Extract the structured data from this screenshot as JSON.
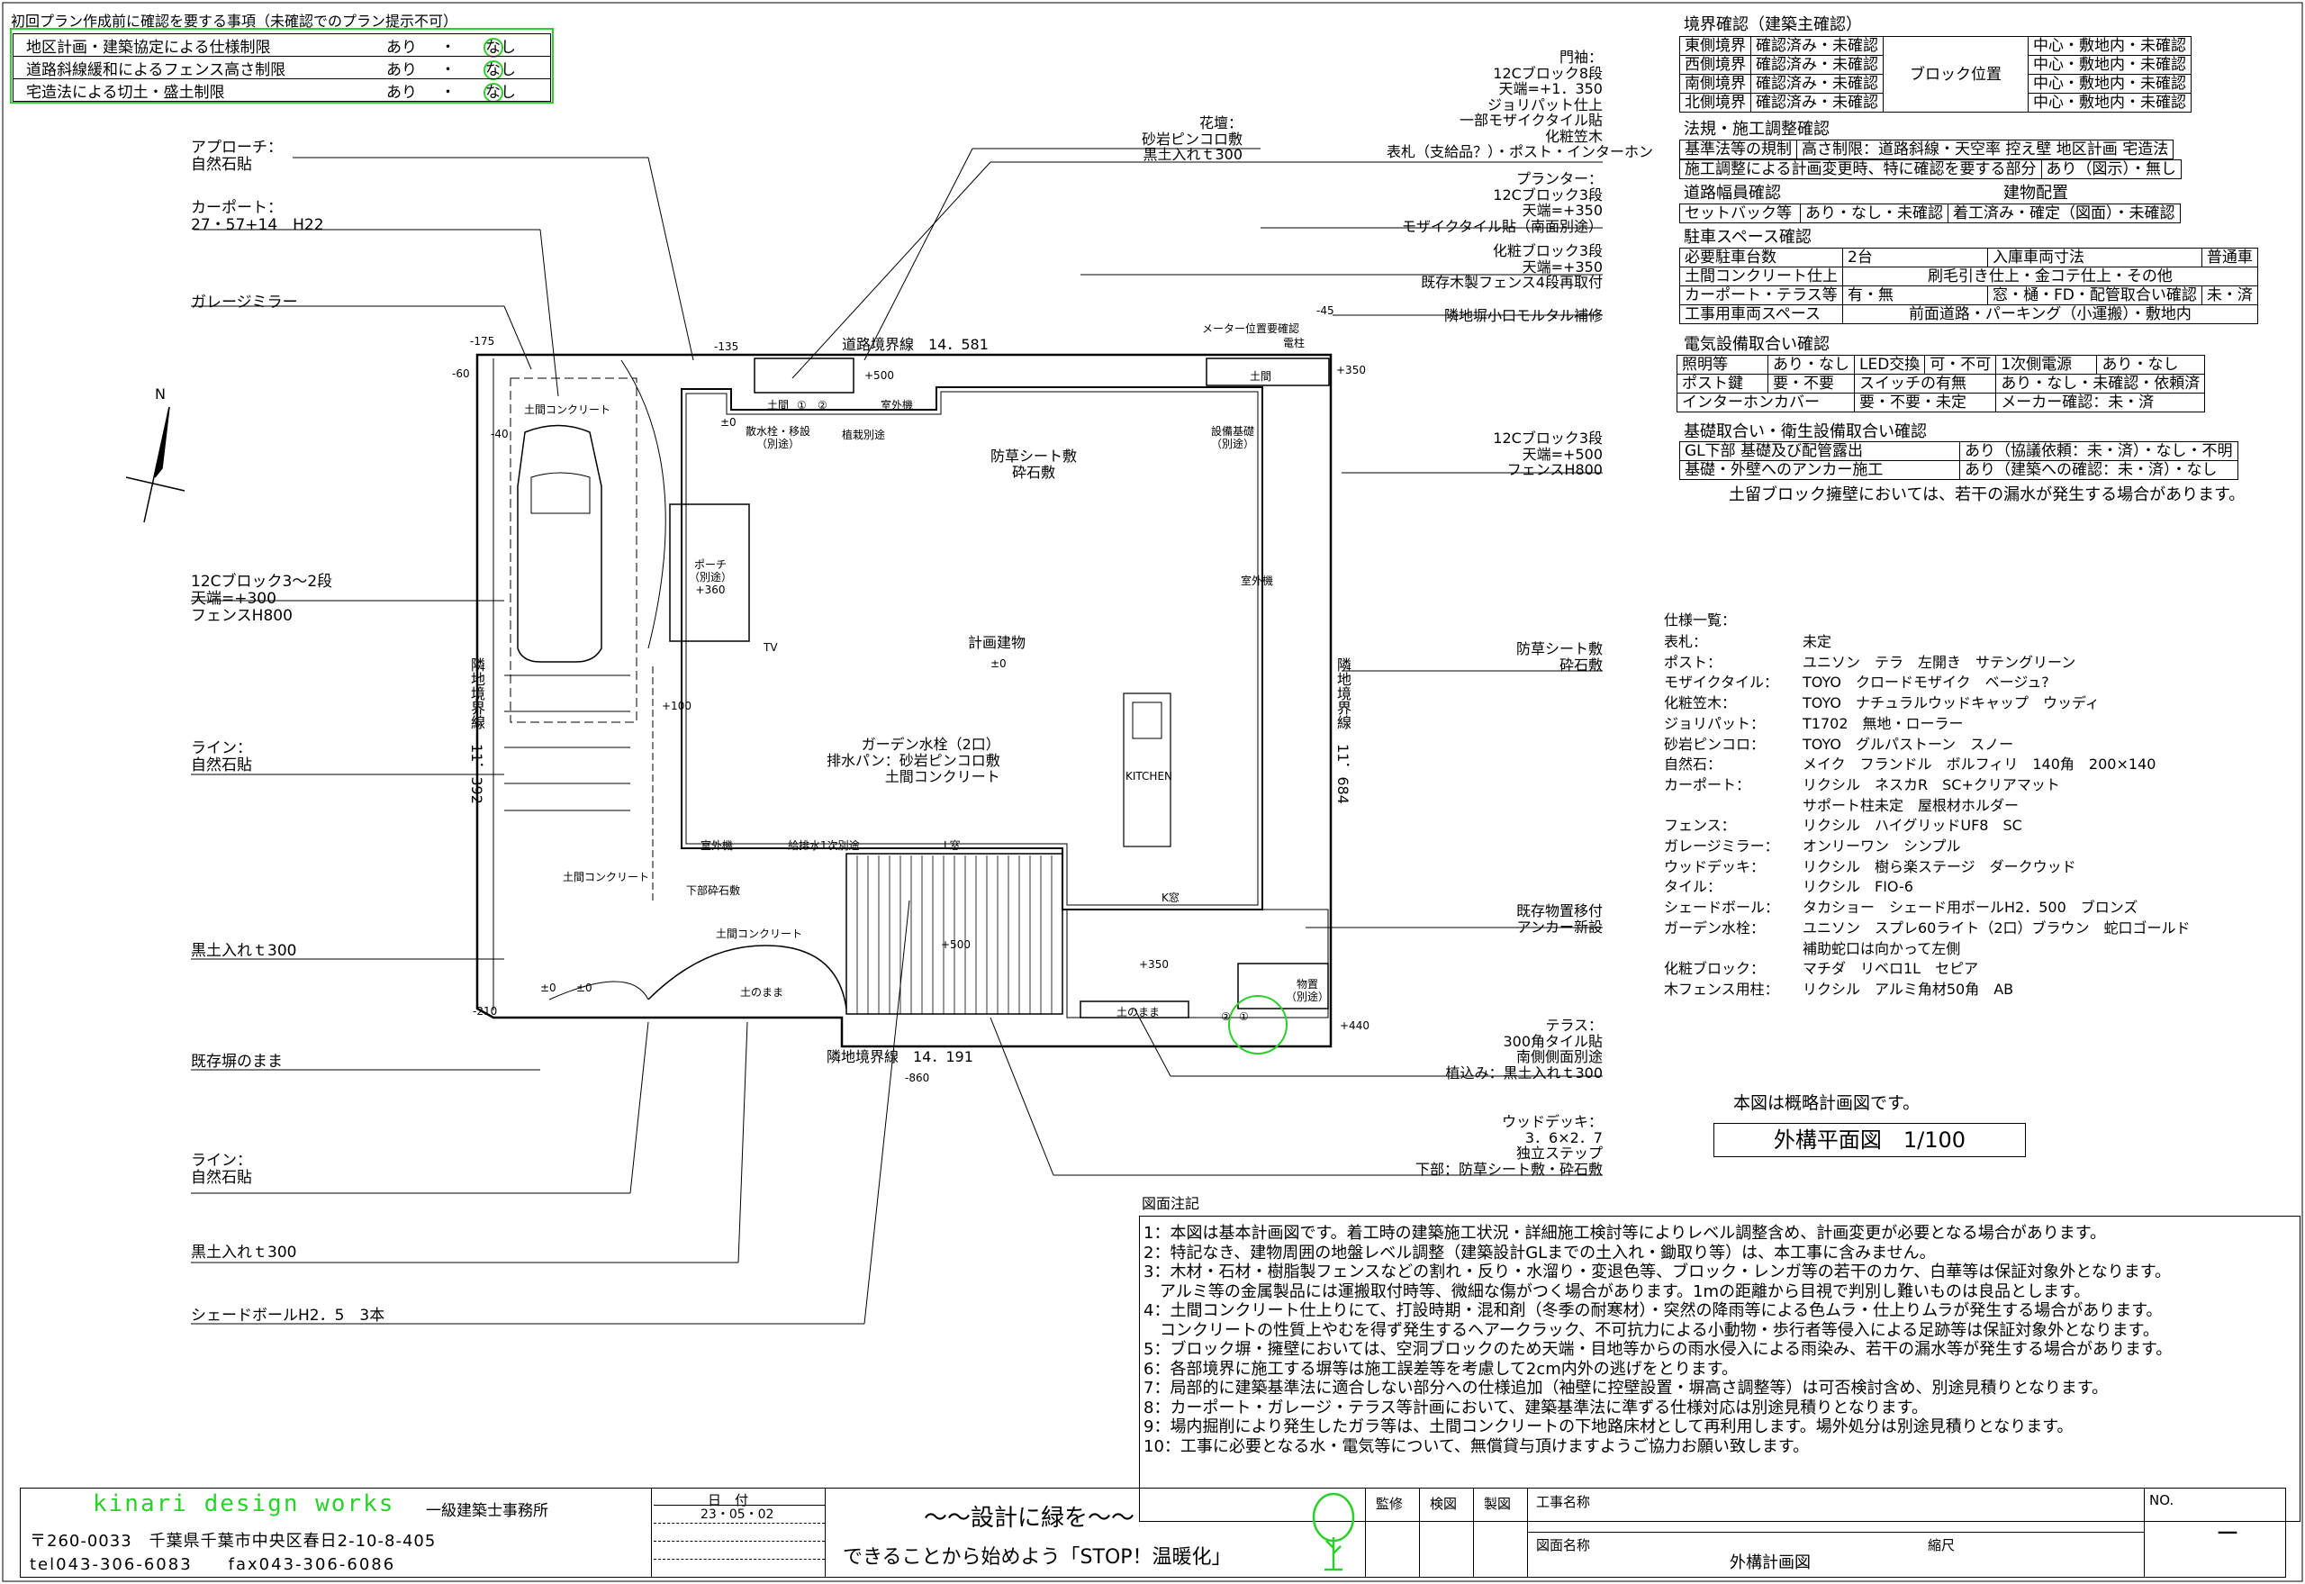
{
  "top_check": {
    "title": "初回プラン作成前に確認を要する事項（未確認でのプラン提示不可）",
    "rows": [
      {
        "item": "地区計画・建築協定による仕様制限",
        "opt1": "あり",
        "sep": "・",
        "opt2": "なし"
      },
      {
        "item": "道路斜線緩和によるフェンス高さ制限",
        "opt1": "あり",
        "sep": "・",
        "opt2": "なし"
      },
      {
        "item": "宅造法による切土・盛土制限",
        "opt1": "あり",
        "sep": "・",
        "opt2": "なし"
      }
    ]
  },
  "left_labels": [
    {
      "text": "アプローチ：\n自然石貼"
    },
    {
      "text": "カーポート：\n27・57+14　H22"
    },
    {
      "text": "ガレージミラー"
    },
    {
      "text": "12Cブロック3～2段\n天端=+300\nフェンスH800"
    },
    {
      "text": "ライン：\n自然石貼"
    },
    {
      "text": "黒土入れｔ300"
    },
    {
      "text": "既存塀のまま"
    },
    {
      "text": "ライン：\n自然石貼"
    },
    {
      "text": "黒土入れｔ300"
    },
    {
      "text": "シェードボールH2．5　3本"
    }
  ],
  "right_labels": [
    {
      "text": "門袖：\n12Cブロック8段\n天端=+1．350\nジョリパット仕上\n一部モザイクタイル貼\n化粧笠木\n表札（支給品？）・ポスト・インターホン"
    },
    {
      "text": "花壇：\n砂岩ピンコロ敷\n黒土入れｔ300"
    },
    {
      "text": "プランター：\n12Cブロック3段\n天端=+350\nモザイクタイル貼（南面別途）"
    },
    {
      "text": "化粧ブロック3段\n天端=+350\n既存木製フェンス4段再取付"
    },
    {
      "text": "隣地塀小口モルタル補修"
    },
    {
      "text": "12Cブロック3段\n天端=+500\nフェンスH800"
    },
    {
      "text": "防草シート敷\n砕石敷"
    },
    {
      "text": "既存物置移付\nアンカー新設"
    },
    {
      "text": "テラス：\n300角タイル貼\n南側側面別途\n植込み：黒土入れｔ300"
    },
    {
      "text": "ウッドデッキ：\n3．6×2．7\n独立ステップ\n下部：防草シート敷・砕石敷"
    }
  ],
  "plan": {
    "north": "N",
    "road": "道路境界線　14．581",
    "south": "隣地境界線　14．191",
    "west": "隣地境界線　11．392",
    "east": "隣地境界線　11．684",
    "building": "計画建物",
    "building_level": "±0",
    "garden_tap": "ガーデン水栓（2口）\n排水パン：砂岩ピンコロ敷\n土間コンクリート",
    "kitchen": "KITCHEN",
    "tv": "TV",
    "porch": "ポーチ\n（別途）\n+360",
    "grass": "防草シート敷\n砕石敷",
    "small_texts": [
      "散水栓・移設\n（別途）",
      "植栽別途",
      "室外機",
      "設備基礎\n（別途）",
      "室外機",
      "室外機",
      "給排水1次別途",
      "L窓",
      "K窓",
      "下部砕石敷",
      "土間コンクリート",
      "土間コンクリート",
      "土間コンクリート",
      "土のまま",
      "土のまま",
      "物置\n（別途）",
      "メーター位置要確認",
      "電柱",
      "土間",
      "土間",
      "①",
      "②",
      "①",
      "②"
    ],
    "levels": [
      "-175",
      "-60",
      "-135",
      "-45",
      "+500",
      "+350",
      "±0",
      "-40",
      "+100",
      "±0",
      "+500",
      "+350",
      "-210",
      "-860",
      "+440",
      "±0"
    ]
  },
  "checklist": {
    "boundary_title": "境界確認（建築主確認）",
    "boundary": [
      {
        "side": "東側境界",
        "status": "確認済み・未確認",
        "pos": "中心・敷地内・未確認"
      },
      {
        "side": "西側境界",
        "status": "確認済み・未確認",
        "pos": "中心・敷地内・未確認"
      },
      {
        "side": "南側境界",
        "status": "確認済み・未確認",
        "pos": "中心・敷地内・未確認"
      },
      {
        "side": "北側境界",
        "status": "確認済み・未確認",
        "pos": "中心・敷地内・未確認"
      }
    ],
    "block_pos": "ブロック位置",
    "law_title": "法規・施工調整確認",
    "law1_a": "基準法等の規制",
    "law1_b": "高さ制限：道路斜線・天空率  控え壁  地区計画  宅造法",
    "law2_a": "施工調整による計画変更時、特に確認を要する部分",
    "law2_b": "あり（図示）・無し",
    "road_title": "道路幅員確認",
    "bldg_title": "建物配置",
    "road_a": "セットバック等",
    "road_b": "あり・なし・未確認",
    "bldg_b": "着工済み・確定（図面）・未確認",
    "parking_title": "駐車スペース確認",
    "p1_a": "必要駐車台数",
    "p1_b": "2台",
    "p1_c": "入庫車両寸法",
    "p1_d": "普通車",
    "p2_a": "土間コンクリート仕上",
    "p2_b": "刷毛引き仕上・金コテ仕上・その他",
    "p3_a": "カーポート・テラス等",
    "p3_b": "有・無",
    "p3_c": "窓・樋・FD・配管取合い確認",
    "p3_d": "未・済",
    "p4_a": "工事用車両スペース",
    "p4_b": "前面道路・パーキング（小運搬）・敷地内",
    "elec_title": "電気設備取合い確認",
    "e1_a": "照明等",
    "e1_b": "あり・なし",
    "e1_c": "LED交換",
    "e1_d": "可・不可",
    "e1_e": "1次側電源",
    "e1_f": "あり・なし",
    "e2_a": "ポスト鍵",
    "e2_b": "要・不要",
    "e2_c": "スイッチの有無",
    "e2_d": "あり・なし・未確認・依頼済",
    "e3_a": "インターホンカバー",
    "e3_b": "要・不要・未定",
    "e3_c": "メーカー確認：未・済",
    "base_title": "基礎取合い・衛生設備取合い確認",
    "b1_a": "GL下部  基礎及び配管露出",
    "b1_b": "あり（協議依頼：未・済）・なし・不明",
    "b2_a": "基礎・外壁へのアンカー施工",
    "b2_b": "あり（建築への確認：未・済）・なし",
    "note": "土留ブロック擁壁においては、若干の漏水が発生する場合があります。"
  },
  "spec_title": "仕様一覧：",
  "specs": [
    [
      "表札：",
      "未定"
    ],
    [
      "ポスト：",
      "ユニソン　テラ　左開き　サテングリーン"
    ],
    [
      "モザイクタイル：",
      "TOYO　クロードモザイク　ベージュ?"
    ],
    [
      "化粧笠木：",
      "TOYO　ナチュラルウッドキャップ　ウッディ"
    ],
    [
      "ジョリパット：",
      "T1702　無地・ローラー"
    ],
    [
      "砂岩ピンコロ：",
      "TOYO　グルパストーン　スノー"
    ],
    [
      "自然石：",
      "メイク　フランドル　ボルフィリ　140角　200×140"
    ],
    [
      "カーポート：",
      "リクシル　ネスカR　SC+クリアマット"
    ],
    [
      "",
      "サポート柱未定　屋根材ホルダー"
    ],
    [
      "フェンス：",
      "リクシル　ハイグリッドUF8　SC"
    ],
    [
      "ガレージミラー：",
      "オンリーワン　シンプル"
    ],
    [
      "ウッドデッキ：",
      "リクシル　樹ら楽ステージ　ダークウッド"
    ],
    [
      "タイル：",
      "リクシル　FIO-6"
    ],
    [
      "シェードボール：",
      "タカショー　シェード用ボールH2．500　ブロンズ"
    ],
    [
      "ガーデン水栓：",
      "ユニソン　スプレ60ライト（2口）ブラウン　蛇口ゴールド"
    ],
    [
      "",
      "補助蛇口は向かって左側"
    ],
    [
      "化粧ブロック：",
      "マチダ　リベロ1L　セピア"
    ],
    [
      "木フェンス用柱：",
      "リクシル　アルミ角材50角　AB"
    ]
  ],
  "note_rough": "本図は概略計画図です。",
  "drawing_title": "外構平面図　1/100",
  "notes_title": "図面注記",
  "notes": [
    "1：本図は基本計画図です。着工時の建築施工状況・詳細施工検討等によりレベル調整含め、計画変更が必要となる場合があります。",
    "2：特記なき、建物周囲の地盤レベル調整（建築設計GLまでの土入れ・鋤取り等）は、本工事に含みません。",
    "3：木材・石材・樹脂製フェンスなどの割れ・反り・水溜り・変退色等、ブロック・レンガ等の若干のカケ、白華等は保証対象外となります。",
    "　アルミ等の金属製品には運搬取付時等、微細な傷がつく場合があります。1mの距離から目視で判別し難いものは良品とします。",
    "4：土間コンクリート仕上りにて、打設時期・混和剤（冬季の耐寒材）・突然の降雨等による色ムラ・仕上りムラが発生する場合があります。",
    "　コンクリートの性質上やむを得ず発生するヘアークラック、不可抗力による小動物・歩行者等侵入による足跡等は保証対象外となります。",
    "5：ブロック塀・擁壁においては、空洞ブロックのため天端・目地等からの雨水侵入による雨染み、若干の漏水等が発生する場合があります。",
    "6：各部境界に施工する塀等は施工誤差等を考慮して2cm内外の逃げをとります。",
    "7：局部的に建築基準法に適合しない部分への仕様追加（袖壁に控壁設置・塀高さ調整等）は可否検討含め、別途見積りとなります。",
    "8：カーポート・ガレージ・テラス等計画において、建築基準法に準ずる仕様対応は別途見積りとなります。",
    "9：場内掘削により発生したガラ等は、土間コンクリートの下地路床材として再利用します。場外処分は別途見積りとなります。",
    "10：工事に必要となる水・電気等について、無償貸与頂けますようご協力お願い致します。"
  ],
  "titleblock": {
    "company": "kinari design works",
    "company_sub": "一級建築士事務所",
    "address": "〒260-0033　千葉県千葉市中央区春日2-10-8-405",
    "tel": "tel043-306-6083　　fax043-306-6086",
    "date_label": "日　付",
    "date": "23・05・02",
    "slogan1": "～～設計に緑を～～",
    "slogan2": "できることから始めよう「STOP！温暖化」",
    "kanshu": "監修",
    "kenin": "検図",
    "seizu": "製図",
    "koji_label": "工事名称",
    "zumen_label": "図面名称",
    "zumen": "外構計画図",
    "shukushaku": "縮尺",
    "no_label": "NO.",
    "no": "ー"
  },
  "colors": {
    "line": "#000000",
    "highlight": "#2bd12b"
  }
}
